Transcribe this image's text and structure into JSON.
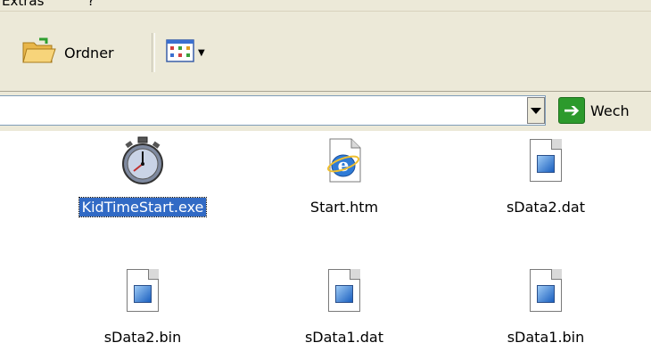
{
  "menubar": {
    "extras_label": "Extras",
    "help_label": "?"
  },
  "toolbar": {
    "folders_label": "Ordner",
    "views_icon": "views-grid-icon"
  },
  "addressbar": {
    "value": "",
    "go_label": "Wech"
  },
  "colors": {
    "selection": "#316ac5",
    "toolbar_bg": "#ece9d8",
    "go_green": "#2c9a2c"
  },
  "files": [
    {
      "name": "KidTimeStart.exe",
      "icon": "stopwatch-icon",
      "selected": true
    },
    {
      "name": "Start.htm",
      "icon": "ie-document-icon",
      "selected": false
    },
    {
      "name": "sData2.dat",
      "icon": "document-icon",
      "selected": false
    },
    {
      "name": "sData2.bin",
      "icon": "document-icon",
      "selected": false
    },
    {
      "name": "sData1.dat",
      "icon": "document-icon",
      "selected": false
    },
    {
      "name": "sData1.bin",
      "icon": "document-icon",
      "selected": false
    }
  ]
}
